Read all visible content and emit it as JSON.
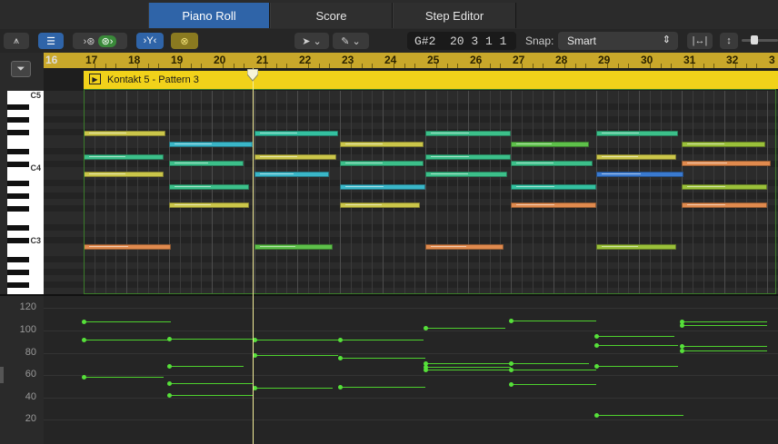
{
  "tabs": [
    {
      "label": "Piano Roll",
      "active": true
    },
    {
      "label": "Score",
      "active": false
    },
    {
      "label": "Step Editor",
      "active": false
    }
  ],
  "toolbar": {
    "lcd": "G#2  20 3 1 1",
    "snap_label": "Snap:",
    "snap_value": "Smart",
    "pointer_tool": "pointer-icon",
    "pencil_tool": "pencil-icon"
  },
  "ruler": {
    "bars": [
      "16",
      "17",
      "18",
      "19",
      "20",
      "21",
      "22",
      "23",
      "24",
      "25",
      "26",
      "27",
      "28",
      "29",
      "30",
      "31",
      "32",
      "3"
    ]
  },
  "region": {
    "name": "Kontakt 5 - Pattern 3"
  },
  "keyboard": {
    "c_labels": [
      "C5",
      "C4",
      "C3"
    ]
  },
  "velocity_axis": {
    "labels": [
      "120",
      "100",
      "80",
      "60",
      "40",
      "20"
    ]
  },
  "colors": {
    "accent": "#2f64a8",
    "region": "#f1d21a",
    "ruler": "#c9a82a",
    "playhead": "#f4ee9a",
    "velocity": "#4ed12e"
  }
}
